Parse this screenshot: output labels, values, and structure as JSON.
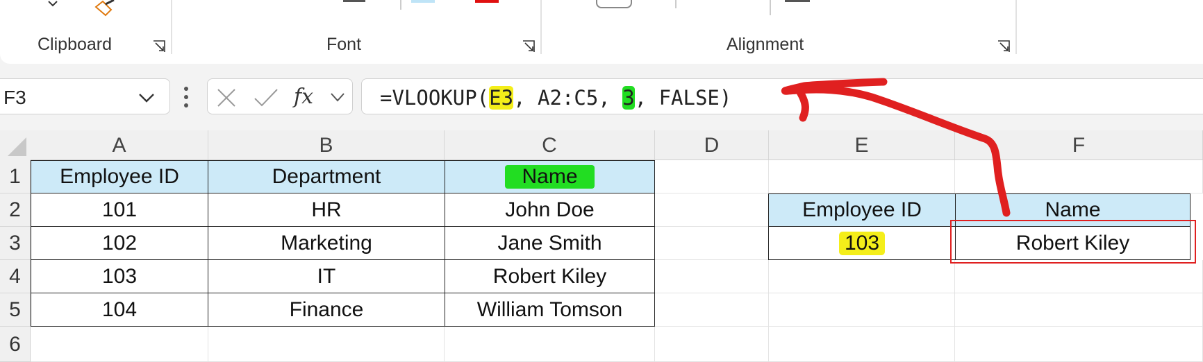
{
  "ribbon": {
    "groups": [
      {
        "label": "Clipboard"
      },
      {
        "label": "Font"
      },
      {
        "label": "Alignment"
      }
    ]
  },
  "formula_bar": {
    "name_box": "F3",
    "formula_parts": [
      "=VLOOKUP(",
      "E3",
      ", A2:C5, ",
      "3",
      ", FALSE)"
    ],
    "fx_label": "fx"
  },
  "columns": [
    "A",
    "B",
    "C",
    "D",
    "E",
    "F"
  ],
  "rows": [
    "1",
    "2",
    "3",
    "4",
    "5",
    "6"
  ],
  "table": {
    "headers": [
      "Employee ID",
      "Department",
      "Name"
    ],
    "rows": [
      [
        "101",
        "HR",
        "John Doe"
      ],
      [
        "102",
        "Marketing",
        "Jane Smith"
      ],
      [
        "103",
        "IT",
        "Robert Kiley"
      ],
      [
        "104",
        "Finance",
        "William Tomson"
      ]
    ]
  },
  "lookup": {
    "headers": [
      "Employee ID",
      "Name"
    ],
    "values": [
      "103",
      "Robert Kiley"
    ]
  },
  "colors": {
    "header_fill": "#cdeaf8",
    "highlight_yellow": "#f4ee1a",
    "highlight_green": "#22dd22",
    "annotation_red": "#e02020"
  }
}
